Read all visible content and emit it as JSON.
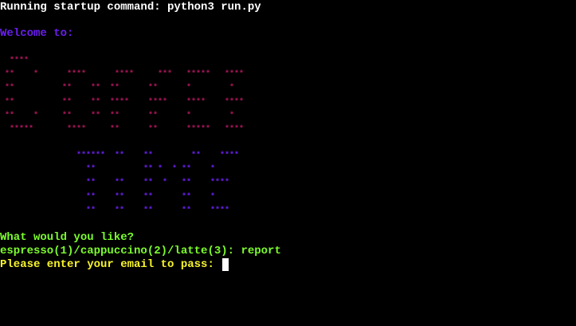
{
  "terminal": {
    "startup_command": "Running startup command: python3 run.py",
    "welcome": "Welcome to:",
    "ascii_coffee": "  ****\n **    *      ****      ****     ***   *****   ****\n **          **    **  **      **      *        *\n **          **    **  ****    ****    ****    ****\n **    *     **    **  **      **      *        *\n  *****       ****     **      **      *****   ****",
    "ascii_machine": "                ******  **    **        **    ****\n                  **          ** *  * **    *\n                  **    **    **  *   **    ****\n                  **    **    **      **    *\n                  **    **    **      **    ****",
    "question": "What would you like?",
    "options_prompt": "espresso(1)/cappuccino(2)/latte(3): report",
    "email_prompt": "Please enter your email to pass: "
  },
  "colors": {
    "background": "#000000",
    "startup_text": "#ffffff",
    "welcome_text": "#6a1ef0",
    "ascii_coffee": "#b0155e",
    "ascii_machine": "#6a1ef0",
    "prompt_green": "#7cfc2e",
    "prompt_yellow": "#f7f42b"
  }
}
